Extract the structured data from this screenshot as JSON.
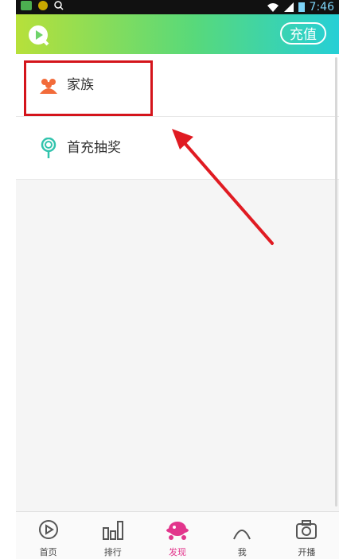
{
  "status_bar": {
    "time": "7:46"
  },
  "header": {
    "recharge_label": "充值"
  },
  "list": {
    "items": [
      {
        "label": "家族",
        "icon": "family-icon"
      },
      {
        "label": "首充抽奖",
        "icon": "lollipop-icon"
      }
    ]
  },
  "bottom_nav": {
    "items": [
      {
        "label": "首页",
        "icon": "play-icon"
      },
      {
        "label": "排行",
        "icon": "ranking-icon"
      },
      {
        "label": "发现",
        "icon": "discover-icon"
      },
      {
        "label": "我",
        "icon": "profile-icon"
      },
      {
        "label": "开播",
        "icon": "camera-icon"
      }
    ],
    "active_index": 2
  },
  "colors": {
    "accent": "#e2358c",
    "highlight_box": "#d4141b",
    "arrow": "#e01b22",
    "header_start": "#b7e03a",
    "header_end": "#25cfd6"
  }
}
